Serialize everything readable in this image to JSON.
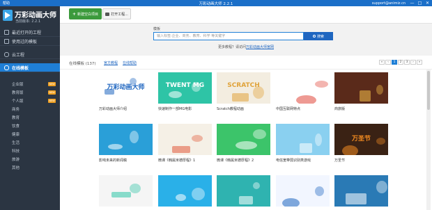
{
  "titlebar": {
    "help": "帮助",
    "title": "万彩动画大师 2.2.1",
    "email": "support@animiz.cn",
    "minimize": "—",
    "maximize": "□",
    "close": "✕"
  },
  "sidebar": {
    "app_name": "万彩动画大师",
    "version": "当前版本: 2.2.1",
    "nav": [
      {
        "label": "最近打开的工程"
      },
      {
        "label": "使用过的模板"
      },
      {
        "label": "云工程"
      },
      {
        "label": "在线模板"
      }
    ],
    "sub_items": [
      {
        "label": "企业版",
        "badge": "NEW"
      },
      {
        "label": "教育版",
        "badge": "NEW"
      },
      {
        "label": "个人版",
        "badge": "NEW"
      },
      {
        "label": "商务",
        "badge": ""
      },
      {
        "label": "教育",
        "badge": ""
      },
      {
        "label": "饮食",
        "badge": ""
      },
      {
        "label": "健康",
        "badge": ""
      },
      {
        "label": "生活",
        "badge": ""
      },
      {
        "label": "科技",
        "badge": ""
      },
      {
        "label": "旅游",
        "badge": ""
      },
      {
        "label": "其他",
        "badge": ""
      }
    ]
  },
  "toolbar": {
    "new_label": "新建空白项目",
    "open_label": "打开工程..."
  },
  "search": {
    "label": "模板",
    "placeholder": "输入标签:企业、商务、教育、科学 等关键字",
    "button": "搜索",
    "tip_prefix": "更多教程？请访问",
    "tip_link": "万彩动画大师官网"
  },
  "listing": {
    "count_label": "在线模板 (137)",
    "link1": "官方教程",
    "link2": "在线帮助",
    "pages": [
      "«",
      "‹",
      "1",
      "2",
      "3",
      "›",
      "»"
    ]
  },
  "templates": [
    {
      "title": "万彩动画大师介绍",
      "thumb_text": "万彩动画大师",
      "bg": "#ffffff",
      "fg": "#1f66c0"
    },
    {
      "title": "快速制作一部MG电影",
      "thumb_text": "TWENT MG",
      "bg": "#2ec4a6",
      "fg": "#ffffff"
    },
    {
      "title": "Scratch教程动画",
      "thumb_text": "SCRATCH",
      "bg": "#f3ede0",
      "fg": "#e0a33a"
    },
    {
      "title": "中国互联网特点",
      "thumb_text": "",
      "bg": "#ffffff",
      "fg": "#e0473a"
    },
    {
      "title": "商旅版",
      "thumb_text": "",
      "bg": "#5a2a1a",
      "fg": "#f5c04a"
    },
    {
      "title": "影响未来的新闻稿",
      "thumb_text": "",
      "bg": "#2a9fd8",
      "fg": "#ffffff"
    },
    {
      "title": "微课《韩属米德厚程》1",
      "thumb_text": "",
      "bg": "#f5f0e6",
      "fg": "#e05a3a"
    },
    {
      "title": "微课《韩属米德厚程》2",
      "thumb_text": "",
      "bg": "#3cc46a",
      "fg": "#ffffff"
    },
    {
      "title": "电信宽带弱识别类游戏",
      "thumb_text": "",
      "bg": "#8ad0f0",
      "fg": "#ffffff"
    },
    {
      "title": "万圣节",
      "thumb_text": "万圣节",
      "bg": "#3a2214",
      "fg": "#f08a20"
    },
    {
      "title": "",
      "thumb_text": "",
      "bg": "#f5f5f5",
      "fg": "#2ec4a6"
    },
    {
      "title": "",
      "thumb_text": "",
      "bg": "#2ab0e8",
      "fg": "#ffffff"
    },
    {
      "title": "",
      "thumb_text": "",
      "bg": "#2fb3b0",
      "fg": "#ffffff"
    },
    {
      "title": "",
      "thumb_text": "",
      "bg": "#f2f6ff",
      "fg": "#1f66c0"
    },
    {
      "title": "",
      "thumb_text": "",
      "bg": "#2a7ab5",
      "fg": "#ffffff"
    }
  ],
  "colors": {
    "titlebar": "#1b6fc8",
    "sidebar": "#2b3542",
    "accent": "#1f7fd6",
    "new_button": "#3b9a3c",
    "badge": "#f0a020"
  }
}
